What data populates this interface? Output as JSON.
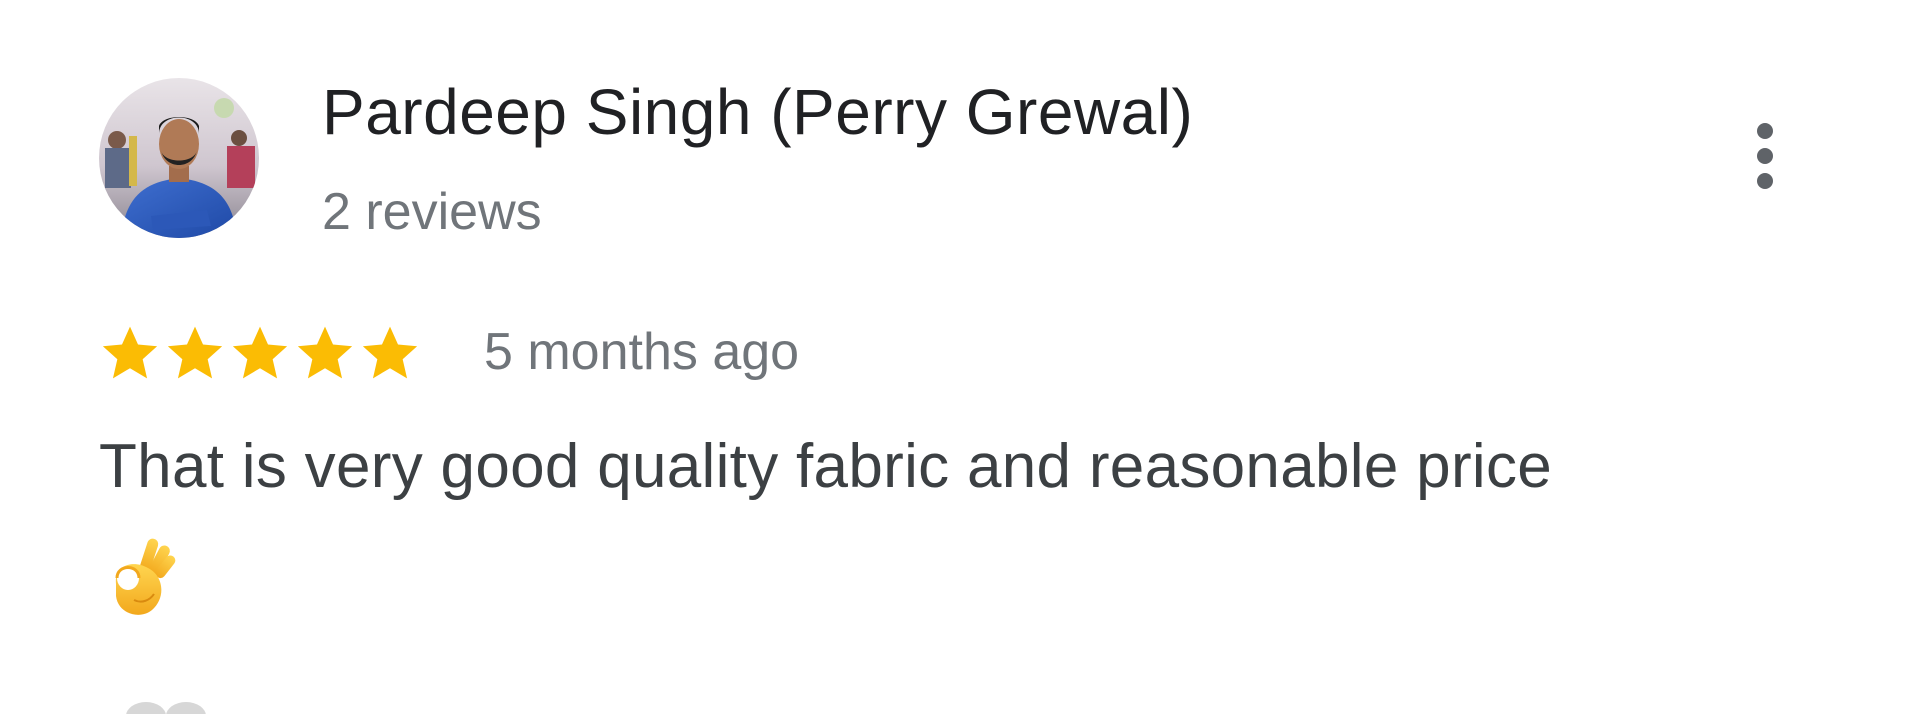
{
  "reviewer": {
    "name": "Pardeep Singh (Perry Grewal)",
    "reviews_count": "2 reviews",
    "avatar_icon": "user-photo-avatar"
  },
  "menu": {
    "icon": "more-vert-icon"
  },
  "review": {
    "rating": 5,
    "rating_max": 5,
    "star_color": "#fbbc04",
    "time": "5 months ago",
    "text": "That is very good quality fabric and reasonable price",
    "emoji_icon": "ok-hand-emoji"
  }
}
